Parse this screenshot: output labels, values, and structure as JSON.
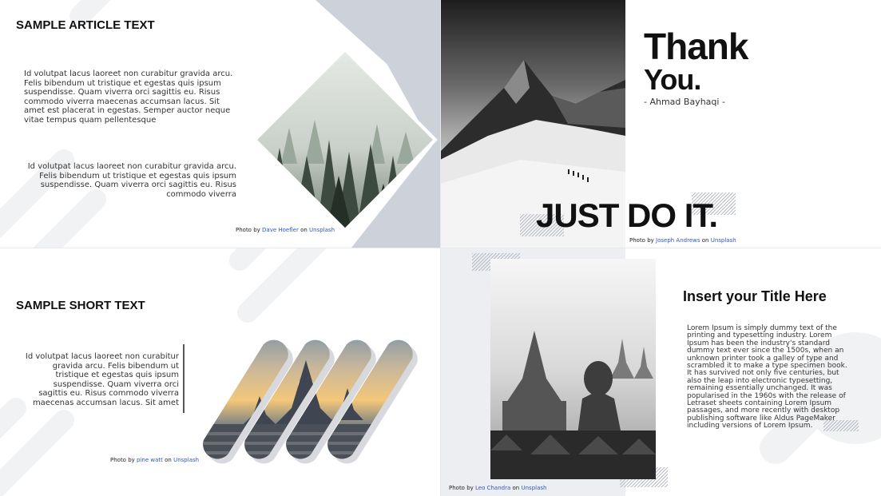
{
  "colors": {
    "accent_link": "#2f56c9",
    "panel_gray": "#cdd1da",
    "light_gray": "#f1f2f4"
  },
  "slide1": {
    "title": "SAMPLE ARTICLE TEXT",
    "para1": "Id volutpat lacus laoreet non curabitur gravida arcu. Felis bibendum ut tristique et egestas quis ipsum suspendisse. Quam viverra orci sagittis eu. Risus commodo viverra maecenas accumsan lacus. Sit amet est placerat in egestas. Semper auctor neque vitae tempus quam pellentesque",
    "para2": "Id volutpat lacus laoreet non curabitur gravida arcu. Felis bibendum ut tristique et egestas quis ipsum suspendisse. Quam viverra orci sagittis eu. Risus commodo viverra",
    "credit": {
      "prefix": "Photo by",
      "author": "Dave Hoefler",
      "on": "on",
      "site": "Unsplash"
    }
  },
  "slide2": {
    "thank": "Thank",
    "you": "You.",
    "author": "- Ahmad Bayhaqi -",
    "slogan": "JUST DO IT.",
    "credit": {
      "prefix": "Photo by",
      "author": "Joseph Andrews",
      "on": "on",
      "site": "Unsplash"
    }
  },
  "slide3": {
    "title": "SAMPLE SHORT TEXT",
    "para": "Id volutpat lacus laoreet non curabitur gravida arcu. Felis bibendum ut tristique et egestas quis ipsum suspendisse. Quam viverra orci sagittis eu. Risus commodo viverra maecenas accumsan lacus. Sit amet",
    "credit": {
      "prefix": "Photo by",
      "author": "pine watt",
      "on": "on",
      "site": "Unsplash"
    }
  },
  "slide4": {
    "title": "Insert your Title Here",
    "para": "Lorem Ipsum is simply dummy text of the printing and typesetting industry. Lorem Ipsum has been the industry's standard dummy text ever since the 1500s, when an unknown printer took a galley of type and scrambled it to make a type specimen book. It has survived not only five centuries, but also the leap into electronic typesetting, remaining essentially unchanged. It was popularised in the 1960s with the release of Letraset sheets containing Lorem Ipsum passages, and more recently with desktop publishing software like Aldus PageMaker including versions of Lorem Ipsum.",
    "credit": {
      "prefix": "Photo by",
      "author": "Leo Chandra",
      "on": "on",
      "site": "Unsplash"
    }
  }
}
